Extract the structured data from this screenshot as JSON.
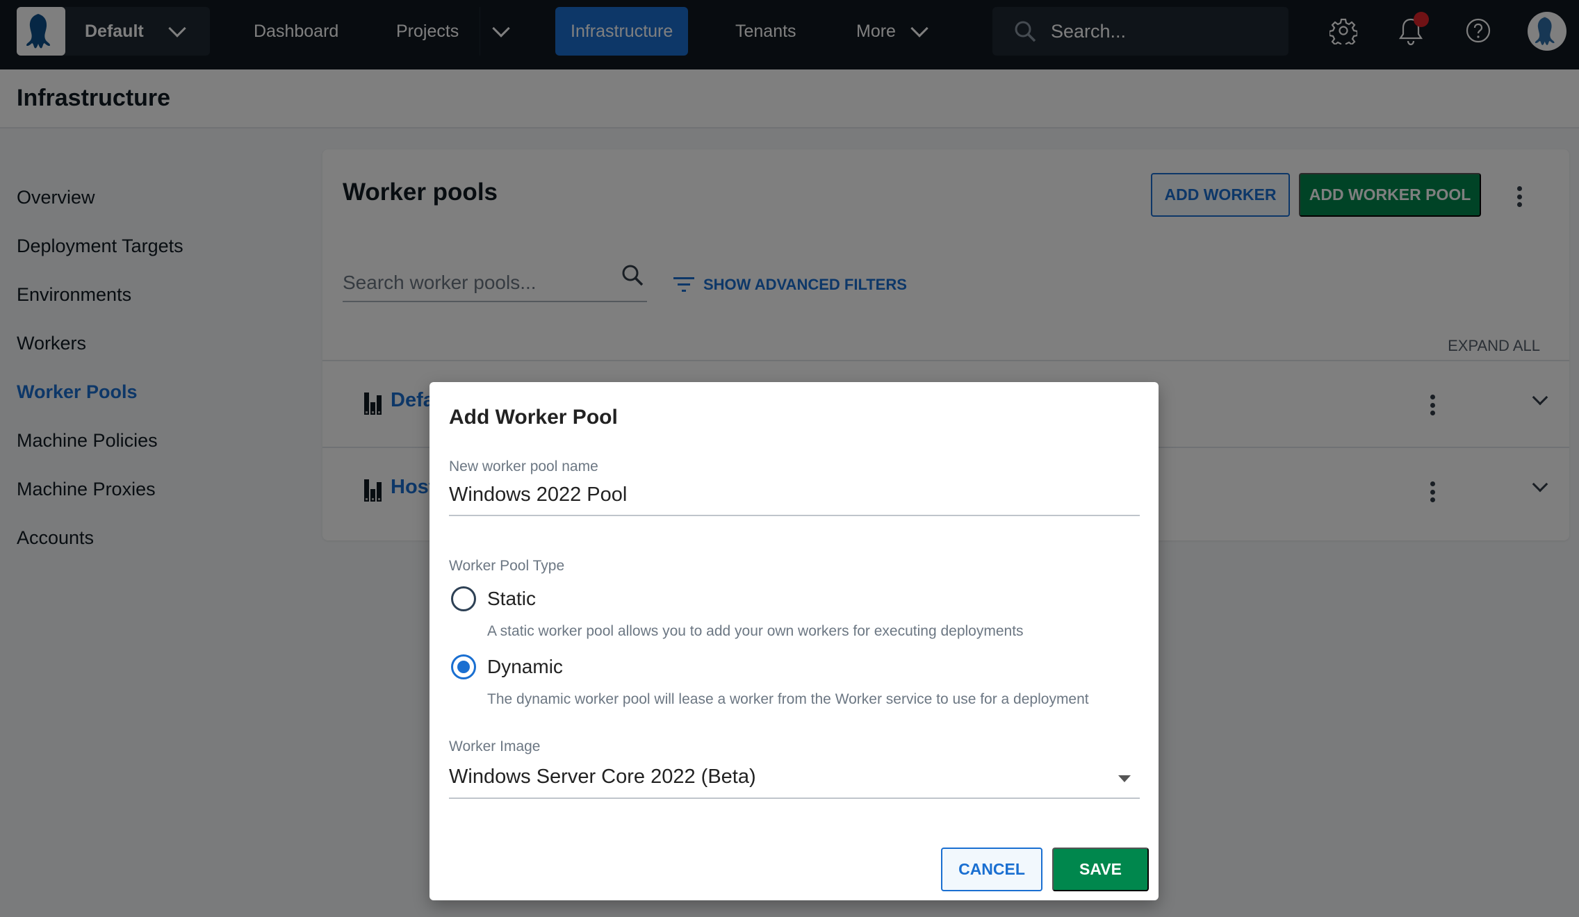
{
  "topnav": {
    "space_name": "Default",
    "links": [
      {
        "label": "Dashboard"
      },
      {
        "label": "Projects"
      },
      {
        "label": "Infrastructure",
        "active": true
      },
      {
        "label": "Tenants"
      },
      {
        "label": "More"
      }
    ],
    "search_placeholder": "Search...",
    "notification_badge": true,
    "icons": [
      "octopus-logo-icon",
      "chevron-down-icon",
      "search-icon",
      "gear-icon",
      "bell-icon",
      "help-icon",
      "avatar-icon"
    ]
  },
  "page": {
    "title": "Infrastructure"
  },
  "sidebar": {
    "items": [
      {
        "label": "Overview"
      },
      {
        "label": "Deployment Targets"
      },
      {
        "label": "Environments"
      },
      {
        "label": "Workers"
      },
      {
        "label": "Worker Pools",
        "active": true
      },
      {
        "label": "Machine Policies"
      },
      {
        "label": "Machine Proxies"
      },
      {
        "label": "Accounts"
      }
    ]
  },
  "card": {
    "title": "Worker pools",
    "add_worker_label": "ADD WORKER",
    "add_worker_pool_label": "ADD WORKER POOL",
    "search_placeholder": "Search worker pools...",
    "advanced_filters_label": "SHOW ADVANCED FILTERS",
    "expand_all_label": "EXPAND ALL",
    "rows": [
      {
        "name_visible": "Defa"
      },
      {
        "name_visible": "Host"
      }
    ]
  },
  "dialog": {
    "title": "Add Worker Pool",
    "name_label": "New worker pool name",
    "name_value": "Windows 2022 Pool",
    "type_label": "Worker Pool Type",
    "options": [
      {
        "label": "Static",
        "description": "A static worker pool allows you to add your own workers for executing deployments",
        "selected": false
      },
      {
        "label": "Dynamic",
        "description": "The dynamic worker pool will lease a worker from the Worker service to use for a deployment",
        "selected": true
      }
    ],
    "image_label": "Worker Image",
    "image_value": "Windows Server Core 2022 (Beta)",
    "cancel_label": "CANCEL",
    "save_label": "SAVE"
  },
  "colors": {
    "nav_bg": "#111820",
    "accent_blue": "#1a6fd1",
    "primary_green": "#00874d",
    "notification_red": "#e0252b",
    "scrim": "rgba(0,0,0,0.5)"
  }
}
